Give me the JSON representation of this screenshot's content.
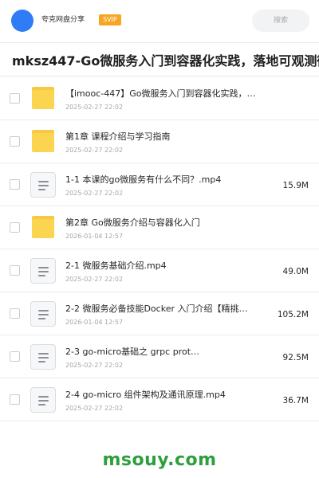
{
  "header": {
    "user_name": "夸克网盘分享",
    "badge": "SVIP",
    "search_placeholder": "搜索"
  },
  "title": "mksz447-Go微服务入门到容器化实践，落地可观测微服务",
  "files": [
    {
      "type": "folder",
      "name": "【imooc-447】Go微服务入门到容器化实践，…",
      "date": "2025-02-27 22:02",
      "size": ""
    },
    {
      "type": "folder",
      "name": "第1章 课程介绍与学习指南",
      "date": "2025-02-27 22:02",
      "size": ""
    },
    {
      "type": "file",
      "name": "1-1 本课的go微服务有什么不同？.mp4",
      "date": "2025-02-27 22:02",
      "size": "15.9M"
    },
    {
      "type": "folder",
      "name": "第2章 Go微服务介绍与容器化入门",
      "date": "2026-01-04 12:57",
      "size": ""
    },
    {
      "type": "file",
      "name": "2-1 微服务基础介绍.mp4",
      "date": "2025-02-27 22:02",
      "size": "49.0M"
    },
    {
      "type": "file",
      "name": "2-2 微服务必备技能Docker 入门介绍【精挑…",
      "date": "2026-01-04 12:57",
      "size": "105.2M"
    },
    {
      "type": "file",
      "name": "2-3 go-micro基础之 grpc prot…",
      "date": "2025-02-27 22:02",
      "size": "92.5M"
    },
    {
      "type": "file",
      "name": "2-4 go-micro 组件架构及通讯原理.mp4",
      "date": "2025-02-27 22:02",
      "size": "36.7M"
    }
  ],
  "watermark": "msouy.com"
}
